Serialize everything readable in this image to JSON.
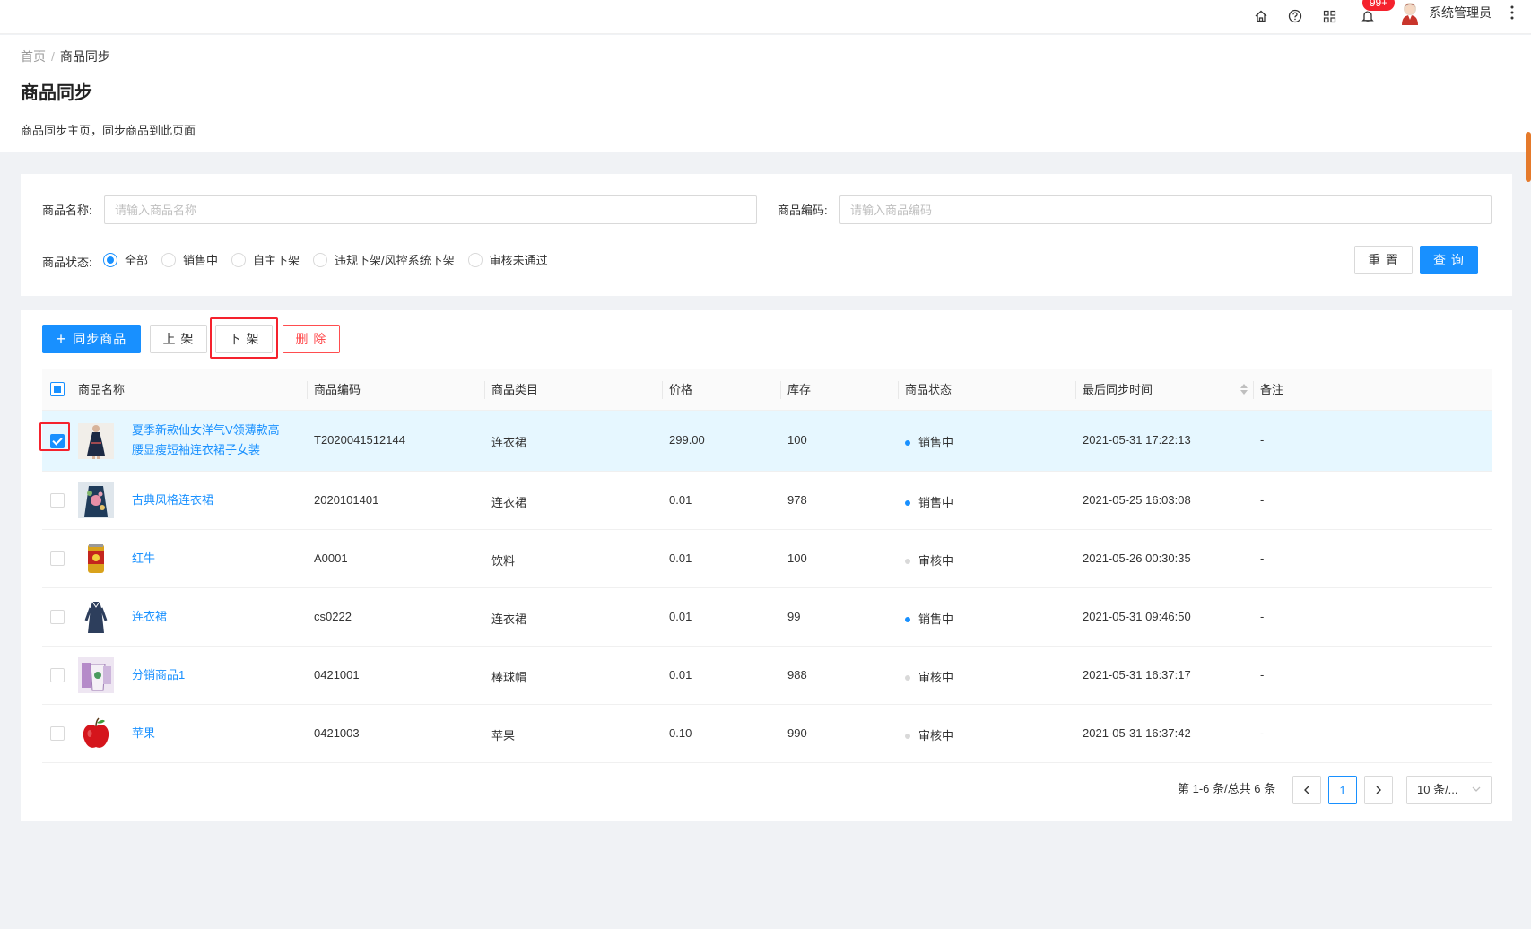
{
  "topbar": {
    "badge": "99+",
    "username": "系统管理员",
    "icons": [
      "home-icon",
      "help-icon",
      "apps-icon",
      "bell-icon",
      "more-icon"
    ]
  },
  "breadcrumb": {
    "home": "首页",
    "sep": "/",
    "current": "商品同步"
  },
  "page": {
    "title": "商品同步",
    "desc": "商品同步主页，同步商品到此页面"
  },
  "search": {
    "name_label": "商品名称:",
    "name_placeholder": "请输入商品名称",
    "code_label": "商品编码:",
    "code_placeholder": "请输入商品编码",
    "status_label": "商品状态:",
    "status_options": [
      "全部",
      "销售中",
      "自主下架",
      "违规下架/风控系统下架",
      "审核未通过"
    ],
    "status_selected": "全部",
    "reset_label": "重 置",
    "query_label": "查 询"
  },
  "toolbar": {
    "sync_label": "同步商品",
    "up_label": "上 架",
    "down_label": "下 架",
    "delete_label": "删 除"
  },
  "table": {
    "columns": [
      "商品名称",
      "商品编码",
      "商品类目",
      "价格",
      "库存",
      "商品状态",
      "最后同步时间",
      "备注"
    ],
    "rows": [
      {
        "name": "夏季新款仙女洋气V领薄款高腰显瘦短袖连衣裙子女装",
        "name_l1": "夏季新款仙女洋气V领薄款高",
        "name_l2": "腰显瘦短袖连衣裙子女装",
        "code": "T2020041512144",
        "category": "连衣裙",
        "price": "299.00",
        "stock": "100",
        "status": "销售中",
        "time": "2021-05-31 17:22:13",
        "note": "-",
        "checked": true
      },
      {
        "name": "古典风格连衣裙",
        "code": "2020101401",
        "category": "连衣裙",
        "price": "0.01",
        "stock": "978",
        "status": "销售中",
        "time": "2021-05-25 16:03:08",
        "note": "-",
        "checked": false
      },
      {
        "name": "红牛",
        "code": "A0001",
        "category": "饮料",
        "price": "0.01",
        "stock": "100",
        "status": "审核中",
        "time": "2021-05-26 00:30:35",
        "note": "-",
        "checked": false
      },
      {
        "name": "连衣裙",
        "code": "cs0222",
        "category": "连衣裙",
        "price": "0.01",
        "stock": "99",
        "status": "销售中",
        "time": "2021-05-31 09:46:50",
        "note": "-",
        "checked": false
      },
      {
        "name": "分销商品1",
        "code": "0421001",
        "category": "棒球帽",
        "price": "0.01",
        "stock": "988",
        "status": "审核中",
        "time": "2021-05-31 16:37:17",
        "note": "-",
        "checked": false
      },
      {
        "name": "苹果",
        "code": "0421003",
        "category": "苹果",
        "price": "0.10",
        "stock": "990",
        "status": "审核中",
        "time": "2021-05-31 16:37:42",
        "note": "-",
        "checked": false
      }
    ]
  },
  "pagination": {
    "total_text": "第 1-6 条/总共 6 条",
    "current": "1",
    "page_size": "10 条/..."
  },
  "colors": {
    "primary": "#1890ff",
    "danger": "#ff4d4f",
    "highlight": "#f5222d",
    "selling_dot": "#1890ff",
    "review_dot": "#d9d9d9"
  }
}
